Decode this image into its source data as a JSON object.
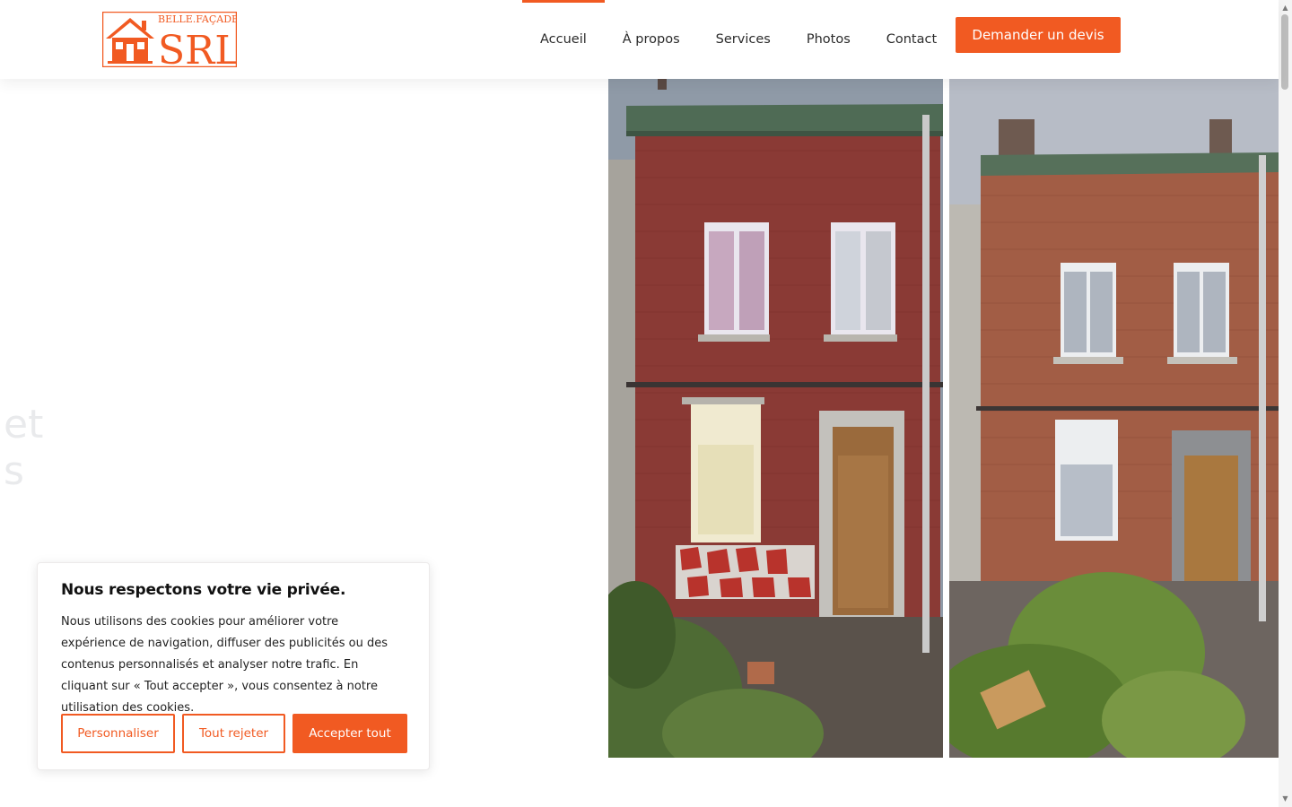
{
  "brand": {
    "logo_text_top": "BELLE.FAÇADE",
    "logo_text_main": "SRL",
    "color": "#f15a22"
  },
  "nav": {
    "items": [
      {
        "label": "Accueil",
        "active": true
      },
      {
        "label": "À propos",
        "active": false
      },
      {
        "label": "Services",
        "active": false
      },
      {
        "label": "Photos",
        "active": false
      },
      {
        "label": "Contact",
        "active": false
      }
    ],
    "cta_label": "Demander un devis"
  },
  "hero": {
    "ghost_line1": "et",
    "ghost_line2": "s"
  },
  "cookie": {
    "title": "Nous respectons votre vie privée.",
    "text": "Nous utilisons des cookies pour améliorer votre expérience de navigation, diffuser des publicités ou des contenus personnalisés et analyser notre trafic. En cliquant sur « Tout accepter », vous consentez à notre utilisation des cookies.",
    "customize_label": "Personnaliser",
    "reject_label": "Tout rejeter",
    "accept_label": "Accepter tout"
  }
}
